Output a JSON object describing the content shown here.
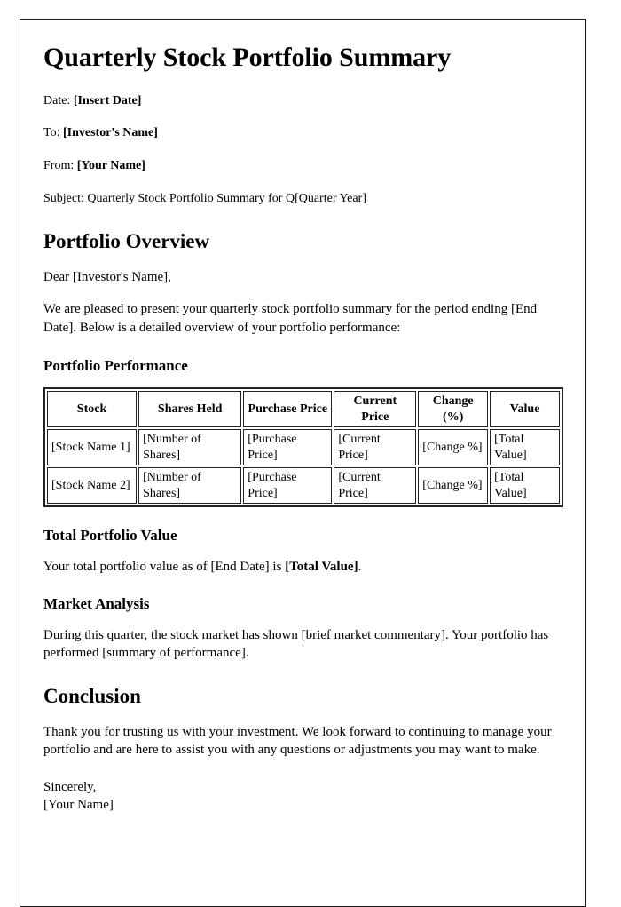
{
  "document": {
    "title": "Quarterly Stock Portfolio Summary",
    "header": {
      "date_label": "Date:",
      "date_value": "[Insert Date]",
      "to_label": "To:",
      "to_value": "[Investor's Name]",
      "from_label": "From:",
      "from_value": "[Your Name]",
      "subject_line": "Subject: Quarterly Stock Portfolio Summary for Q[Quarter Year]"
    },
    "sections": {
      "overview": {
        "heading": "Portfolio Overview",
        "salutation": "Dear [Investor's Name],",
        "intro": "We are pleased to present your quarterly stock portfolio summary for the period ending [End Date]. Below is a detailed overview of your portfolio performance:"
      },
      "performance": {
        "heading": "Portfolio Performance",
        "table": {
          "columns": [
            "Stock",
            "Shares Held",
            "Purchase Price",
            "Current Price",
            "Change (%)",
            "Value"
          ],
          "rows": [
            [
              "[Stock Name 1]",
              "[Number of Shares]",
              "[Purchase Price]",
              "[Current Price]",
              "[Change %]",
              "[Total Value]"
            ],
            [
              "[Stock Name 2]",
              "[Number of Shares]",
              "[Purchase Price]",
              "[Current Price]",
              "[Change %]",
              "[Total Value]"
            ]
          ]
        }
      },
      "total_value": {
        "heading": "Total Portfolio Value",
        "text_before": "Your total portfolio value as of [End Date] is ",
        "value": "[Total Value]",
        "text_after": "."
      },
      "market_analysis": {
        "heading": "Market Analysis",
        "text": "During this quarter, the stock market has shown [brief market commentary]. Your portfolio has performed [summary of performance]."
      },
      "conclusion": {
        "heading": "Conclusion",
        "text": "Thank you for trusting us with your investment. We look forward to continuing to manage your portfolio and are here to assist you with any questions or adjustments you may want to make.",
        "closing": "Sincerely,",
        "signature": "[Your Name]"
      }
    }
  }
}
